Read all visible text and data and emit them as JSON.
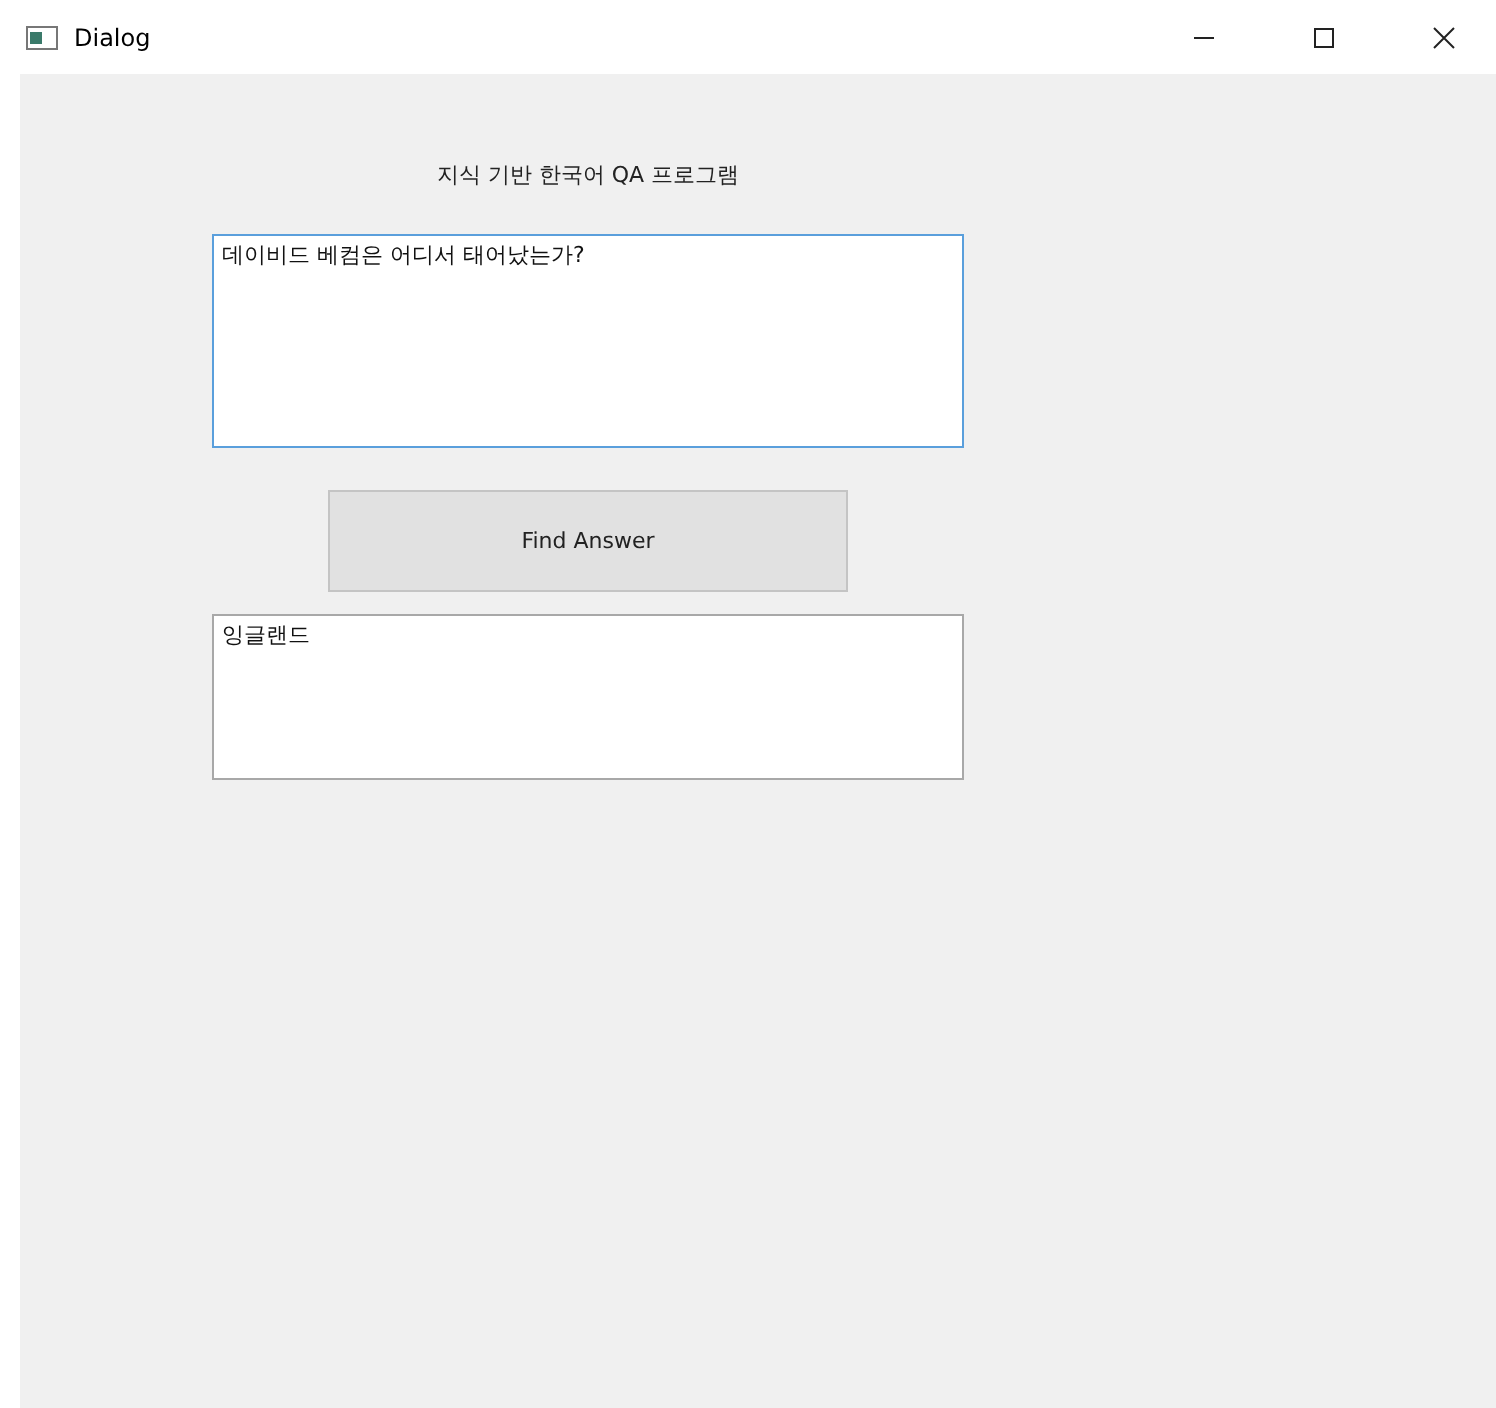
{
  "window": {
    "title": "Dialog"
  },
  "heading": "지식 기반 한국어 QA 프로그램",
  "question": {
    "value": "데이비드 베컴은 어디서 태어났는가?",
    "focused": true
  },
  "button": {
    "label": "Find Answer"
  },
  "answer": {
    "value": "잉글랜드",
    "focused": false
  }
}
